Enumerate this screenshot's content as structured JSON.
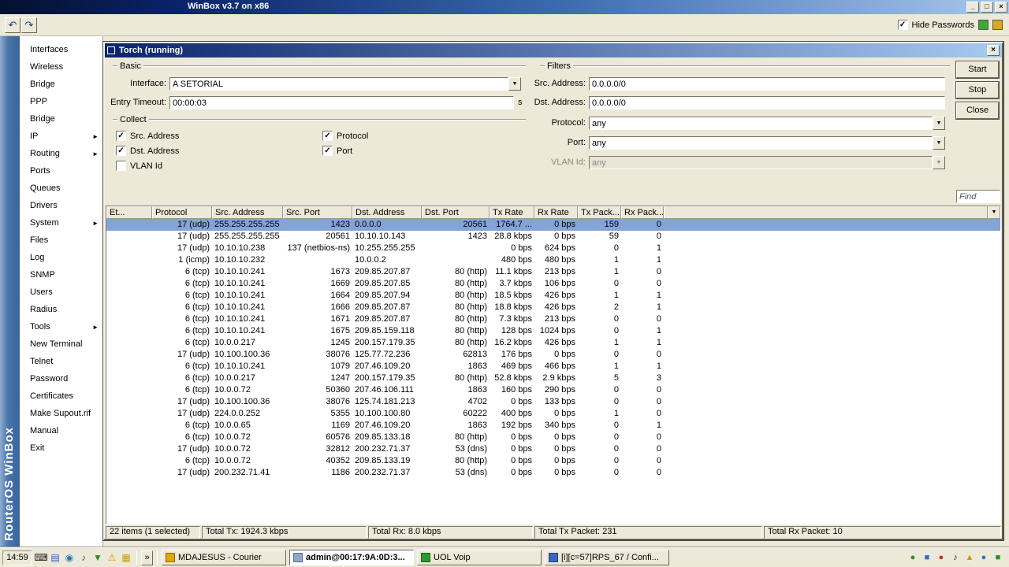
{
  "glyphs": {
    "minimize": "_",
    "maximize": "□",
    "close": "×",
    "undo": "↶",
    "redo": "↷",
    "check": "✓",
    "dropdown": "▼",
    "submenu": "►",
    "overflow": "»"
  },
  "colors": {
    "selection": "#84a3d6",
    "titlebar_accent": "#0a246a"
  },
  "titlebar": {
    "title": "WinBox v3.7 on x86"
  },
  "toolbar": {
    "hide_passwords_label": "Hide Passwords",
    "hide_passwords_checked": true
  },
  "brand": {
    "vertical_text": "RouterOS WinBox"
  },
  "sidebar": {
    "items": [
      {
        "label": "Interfaces",
        "arrow": false
      },
      {
        "label": "Wireless",
        "arrow": false
      },
      {
        "label": "Bridge",
        "arrow": false
      },
      {
        "label": "PPP",
        "arrow": false
      },
      {
        "label": "Bridge",
        "arrow": false
      },
      {
        "label": "IP",
        "arrow": true
      },
      {
        "label": "Routing",
        "arrow": true
      },
      {
        "label": "Ports",
        "arrow": false
      },
      {
        "label": "Queues",
        "arrow": false
      },
      {
        "label": "Drivers",
        "arrow": false
      },
      {
        "label": "System",
        "arrow": true
      },
      {
        "label": "Files",
        "arrow": false
      },
      {
        "label": "Log",
        "arrow": false
      },
      {
        "label": "SNMP",
        "arrow": false
      },
      {
        "label": "Users",
        "arrow": false
      },
      {
        "label": "Radius",
        "arrow": false
      },
      {
        "label": "Tools",
        "arrow": true
      },
      {
        "label": "New Terminal",
        "arrow": false
      },
      {
        "label": "Telnet",
        "arrow": false
      },
      {
        "label": "Password",
        "arrow": false
      },
      {
        "label": "Certificates",
        "arrow": false
      },
      {
        "label": "Make Supout.rif",
        "arrow": false
      },
      {
        "label": "Manual",
        "arrow": false
      },
      {
        "label": "Exit",
        "arrow": false
      }
    ]
  },
  "torch": {
    "title": "Torch (running)",
    "basic": {
      "legend": "Basic",
      "interface_label": "Interface:",
      "interface_value": "A SETORIAL",
      "entry_timeout_label": "Entry Timeout:",
      "entry_timeout_value": "00:00:03",
      "entry_timeout_unit": "s"
    },
    "collect": {
      "legend": "Collect",
      "col1": [
        {
          "label": "Src. Address",
          "checked": true
        },
        {
          "label": "Dst. Address",
          "checked": true
        },
        {
          "label": "VLAN Id",
          "checked": false
        }
      ],
      "col2": [
        {
          "label": "Protocol",
          "checked": true
        },
        {
          "label": "Port",
          "checked": true
        }
      ]
    },
    "filters": {
      "legend": "Filters",
      "src_label": "Src. Address:",
      "src_value": "0.0.0.0/0",
      "dst_label": "Dst. Address:",
      "dst_value": "0.0.0.0/0",
      "protocol_label": "Protocol:",
      "protocol_value": "any",
      "port_label": "Port:",
      "port_value": "any",
      "vlan_label": "VLAN Id:",
      "vlan_value": "any"
    },
    "buttons": {
      "start": "Start",
      "stop": "Stop",
      "close": "Close"
    },
    "find_placeholder": "Find",
    "table": {
      "columns": [
        "Et...",
        "Protocol",
        "Src. Address",
        "Src. Port",
        "Dst. Address",
        "Dst. Port",
        "Tx Rate",
        "Rx Rate",
        "Tx Pack...",
        "Rx Pack..."
      ],
      "rows": [
        {
          "selected": true,
          "proto": "17 (udp)",
          "src": "255.255.255.255",
          "sport": "1423",
          "dst": "0.0.0.0",
          "dport": "20561",
          "tx": "1764.7 ...",
          "rx": "0 bps",
          "txp": "159",
          "rxp": "0"
        },
        {
          "proto": "17 (udp)",
          "src": "255.255.255.255",
          "sport": "20561",
          "dst": "10.10.10.143",
          "dport": "1423",
          "tx": "28.8 kbps",
          "rx": "0 bps",
          "txp": "59",
          "rxp": "0"
        },
        {
          "proto": "17 (udp)",
          "src": "10.10.10.238",
          "sport": "137 (netbios-ns)",
          "dst": "10.255.255.255",
          "dport": "",
          "tx": "0 bps",
          "rx": "624 bps",
          "txp": "0",
          "rxp": "1"
        },
        {
          "proto": "1 (icmp)",
          "src": "10.10.10.232",
          "sport": "",
          "dst": "10.0.0.2",
          "dport": "",
          "tx": "480 bps",
          "rx": "480 bps",
          "txp": "1",
          "rxp": "1"
        },
        {
          "proto": "6 (tcp)",
          "src": "10.10.10.241",
          "sport": "1673",
          "dst": "209.85.207.87",
          "dport": "80 (http)",
          "tx": "11.1 kbps",
          "rx": "213 bps",
          "txp": "1",
          "rxp": "0"
        },
        {
          "proto": "6 (tcp)",
          "src": "10.10.10.241",
          "sport": "1669",
          "dst": "209.85.207.85",
          "dport": "80 (http)",
          "tx": "3.7 kbps",
          "rx": "106 bps",
          "txp": "0",
          "rxp": "0"
        },
        {
          "proto": "6 (tcp)",
          "src": "10.10.10.241",
          "sport": "1664",
          "dst": "209.85.207.94",
          "dport": "80 (http)",
          "tx": "18.5 kbps",
          "rx": "426 bps",
          "txp": "1",
          "rxp": "1"
        },
        {
          "proto": "6 (tcp)",
          "src": "10.10.10.241",
          "sport": "1666",
          "dst": "209.85.207.87",
          "dport": "80 (http)",
          "tx": "18.8 kbps",
          "rx": "426 bps",
          "txp": "2",
          "rxp": "1"
        },
        {
          "proto": "6 (tcp)",
          "src": "10.10.10.241",
          "sport": "1671",
          "dst": "209.85.207.87",
          "dport": "80 (http)",
          "tx": "7.3 kbps",
          "rx": "213 bps",
          "txp": "0",
          "rxp": "0"
        },
        {
          "proto": "6 (tcp)",
          "src": "10.10.10.241",
          "sport": "1675",
          "dst": "209.85.159.118",
          "dport": "80 (http)",
          "tx": "128 bps",
          "rx": "1024 bps",
          "txp": "0",
          "rxp": "1"
        },
        {
          "proto": "6 (tcp)",
          "src": "10.0.0.217",
          "sport": "1245",
          "dst": "200.157.179.35",
          "dport": "80 (http)",
          "tx": "16.2 kbps",
          "rx": "426 bps",
          "txp": "1",
          "rxp": "1"
        },
        {
          "proto": "17 (udp)",
          "src": "10.100.100.36",
          "sport": "38076",
          "dst": "125.77.72.236",
          "dport": "62813",
          "tx": "176 bps",
          "rx": "0 bps",
          "txp": "0",
          "rxp": "0"
        },
        {
          "proto": "6 (tcp)",
          "src": "10.10.10.241",
          "sport": "1079",
          "dst": "207.46.109.20",
          "dport": "1863",
          "tx": "469 bps",
          "rx": "466 bps",
          "txp": "1",
          "rxp": "1"
        },
        {
          "proto": "6 (tcp)",
          "src": "10.0.0.217",
          "sport": "1247",
          "dst": "200.157.179.35",
          "dport": "80 (http)",
          "tx": "52.8 kbps",
          "rx": "2.9 kbps",
          "txp": "5",
          "rxp": "3"
        },
        {
          "proto": "6 (tcp)",
          "src": "10.0.0.72",
          "sport": "50360",
          "dst": "207.46.106.111",
          "dport": "1863",
          "tx": "160 bps",
          "rx": "290 bps",
          "txp": "0",
          "rxp": "0"
        },
        {
          "proto": "17 (udp)",
          "src": "10.100.100.36",
          "sport": "38076",
          "dst": "125.74.181.213",
          "dport": "4702",
          "tx": "0 bps",
          "rx": "133 bps",
          "txp": "0",
          "rxp": "0"
        },
        {
          "proto": "17 (udp)",
          "src": "224.0.0.252",
          "sport": "5355",
          "dst": "10.100.100.80",
          "dport": "60222",
          "tx": "400 bps",
          "rx": "0 bps",
          "txp": "1",
          "rxp": "0"
        },
        {
          "proto": "6 (tcp)",
          "src": "10.0.0.65",
          "sport": "1169",
          "dst": "207.46.109.20",
          "dport": "1863",
          "tx": "192 bps",
          "rx": "340 bps",
          "txp": "0",
          "rxp": "1"
        },
        {
          "proto": "6 (tcp)",
          "src": "10.0.0.72",
          "sport": "60576",
          "dst": "209.85.133.18",
          "dport": "80 (http)",
          "tx": "0 bps",
          "rx": "0 bps",
          "txp": "0",
          "rxp": "0"
        },
        {
          "proto": "17 (udp)",
          "src": "10.0.0.72",
          "sport": "32812",
          "dst": "200.232.71.37",
          "dport": "53 (dns)",
          "tx": "0 bps",
          "rx": "0 bps",
          "txp": "0",
          "rxp": "0"
        },
        {
          "proto": "6 (tcp)",
          "src": "10.0.0.72",
          "sport": "40352",
          "dst": "209.85.133.19",
          "dport": "80 (http)",
          "tx": "0 bps",
          "rx": "0 bps",
          "txp": "0",
          "rxp": "0"
        },
        {
          "proto": "17 (udp)",
          "src": "200.232.71.41",
          "sport": "1186",
          "dst": "200.232.71.37",
          "dport": "53 (dns)",
          "tx": "0 bps",
          "rx": "0 bps",
          "txp": "0",
          "rxp": "0"
        }
      ]
    },
    "status": [
      "22 items (1 selected)",
      "Total Tx: 1924.3 kbps",
      "Total Rx: 8.0 kbps",
      "Total Tx Packet: 231",
      "Total Rx Packet: 10"
    ]
  },
  "taskbar": {
    "clock": "14:59",
    "quicklaunch": [
      {
        "glyph": "⌨",
        "color": "#1a1a1a"
      },
      {
        "glyph": "▤",
        "color": "#2a5db0"
      },
      {
        "glyph": "◉",
        "color": "#2a7ab8"
      },
      {
        "glyph": "♪",
        "color": "#555555"
      },
      {
        "glyph": "▼",
        "color": "#2d8a2d"
      },
      {
        "glyph": "⚠",
        "color": "#d09a00"
      },
      {
        "glyph": "▦",
        "color": "#c8a000"
      }
    ],
    "buttons": [
      {
        "label": "MDAJESUS - Courier",
        "color": "#e0a800"
      },
      {
        "label": "admin@00:17:9A:0D:3...",
        "color": "#90a8c8",
        "active": true
      },
      {
        "label": "UOL Voip",
        "color": "#2d9a2d"
      },
      {
        "label": "[i][c=57]RPS_67 / Confi...",
        "color": "#3a66c0"
      }
    ],
    "tray": [
      {
        "glyph": "●",
        "color": "#2d8a2d"
      },
      {
        "glyph": "■",
        "color": "#3a66c0"
      },
      {
        "glyph": "●",
        "color": "#c03030"
      },
      {
        "glyph": "♪",
        "color": "#1a1a1a"
      },
      {
        "glyph": "▲",
        "color": "#d09a00"
      },
      {
        "glyph": "●",
        "color": "#2a7ab8"
      },
      {
        "glyph": "■",
        "color": "#2d8a2d"
      }
    ]
  }
}
